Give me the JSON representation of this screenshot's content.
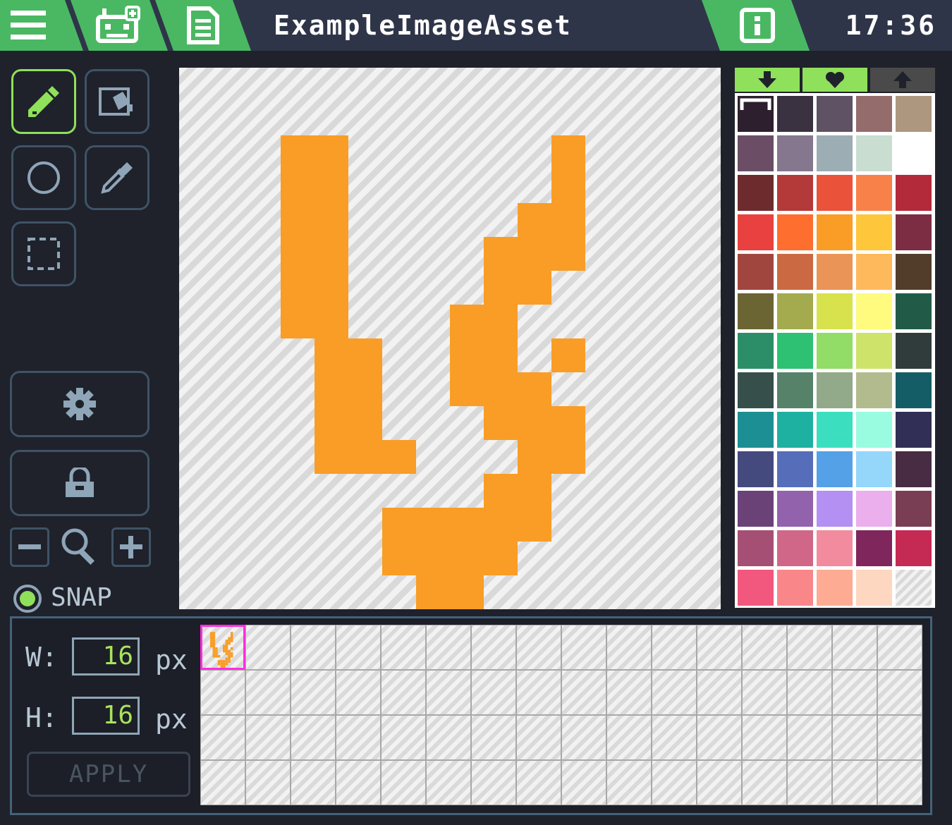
{
  "header": {
    "title": "ExampleImageAsset",
    "clock": "17:36",
    "icons": [
      "menu-icon",
      "robot-add-icon",
      "document-icon",
      "info-icon"
    ]
  },
  "tools": {
    "items": [
      "pencil",
      "fill",
      "circle",
      "eyedropper",
      "marquee-select"
    ],
    "active": "pencil"
  },
  "actions": {
    "settings_icon": "gear-icon",
    "lock_icon": "lock-icon"
  },
  "zoom": {
    "minus": "−",
    "plus": "+"
  },
  "snap": {
    "label": "SNAP",
    "enabled": true
  },
  "palette": {
    "tabs": [
      "download-arrow",
      "heart",
      "upload-arrow"
    ],
    "selected_color": "#2d1f2e",
    "colors": [
      "#2d1f2e",
      "#3b3241",
      "#5e5264",
      "#946c6c",
      "#ad977f",
      "#6b4e66",
      "#85778e",
      "#9cadb4",
      "#c9ddd1",
      "#ffffff",
      "#6e2b2d",
      "#b43a3a",
      "#ea5239",
      "#f88149",
      "#b32a3a",
      "#e9413f",
      "#fe6e2e",
      "#f99d26",
      "#fec63a",
      "#7c2d43",
      "#a1463f",
      "#cb6a42",
      "#ea9457",
      "#fdb95b",
      "#523d2b",
      "#6b6534",
      "#a4ab4e",
      "#d8e24d",
      "#fefb7f",
      "#215b47",
      "#2b8e69",
      "#2ec173",
      "#91dd67",
      "#cee36a",
      "#2f3c3b",
      "#374f4a",
      "#56826a",
      "#92a98a",
      "#b1bb8e",
      "#155d66",
      "#1b8f93",
      "#1eb1a1",
      "#3bdfbf",
      "#99fbe0",
      "#312f55",
      "#444a7d",
      "#566eba",
      "#54a1e7",
      "#95d6fb",
      "#472c43",
      "#6b4278",
      "#9262ad",
      "#b390f1",
      "#eaafec",
      "#7a3e54",
      "#a64f74",
      "#d06789",
      "#f28b9e",
      "#7f265c",
      "#c52a55",
      "#f2577e",
      "#f9878a",
      "#fdab93",
      "#fdd7bf",
      "transparent"
    ]
  },
  "canvas": {
    "size": 16,
    "color": "#f99d26",
    "pixels": [
      [
        3,
        2
      ],
      [
        4,
        2
      ],
      [
        11,
        2
      ],
      [
        3,
        3
      ],
      [
        4,
        3
      ],
      [
        11,
        3
      ],
      [
        3,
        4
      ],
      [
        4,
        4
      ],
      [
        10,
        4
      ],
      [
        11,
        4
      ],
      [
        3,
        5
      ],
      [
        4,
        5
      ],
      [
        9,
        5
      ],
      [
        10,
        5
      ],
      [
        11,
        5
      ],
      [
        3,
        6
      ],
      [
        4,
        6
      ],
      [
        9,
        6
      ],
      [
        10,
        6
      ],
      [
        3,
        7
      ],
      [
        4,
        7
      ],
      [
        8,
        7
      ],
      [
        9,
        7
      ],
      [
        4,
        8
      ],
      [
        5,
        8
      ],
      [
        8,
        8
      ],
      [
        9,
        8
      ],
      [
        4,
        9
      ],
      [
        5,
        9
      ],
      [
        8,
        9
      ],
      [
        9,
        9
      ],
      [
        10,
        9
      ],
      [
        4,
        10
      ],
      [
        5,
        10
      ],
      [
        9,
        10
      ],
      [
        10,
        10
      ],
      [
        11,
        10
      ],
      [
        4,
        11
      ],
      [
        5,
        11
      ],
      [
        10,
        11
      ],
      [
        11,
        11
      ],
      [
        11,
        8
      ],
      [
        6,
        11
      ],
      [
        9,
        12
      ],
      [
        10,
        12
      ],
      [
        6,
        13
      ],
      [
        7,
        13
      ],
      [
        8,
        13
      ],
      [
        9,
        13
      ],
      [
        10,
        13
      ],
      [
        6,
        14
      ],
      [
        7,
        14
      ],
      [
        8,
        14
      ],
      [
        9,
        14
      ],
      [
        7,
        15
      ],
      [
        8,
        15
      ]
    ]
  },
  "size_panel": {
    "w_label": "W:",
    "h_label": "H:",
    "width": "16",
    "height": "16",
    "unit": "px",
    "apply_label": "APPLY"
  },
  "frames": {
    "columns": 16,
    "rows": 4,
    "selected_index": 0
  }
}
